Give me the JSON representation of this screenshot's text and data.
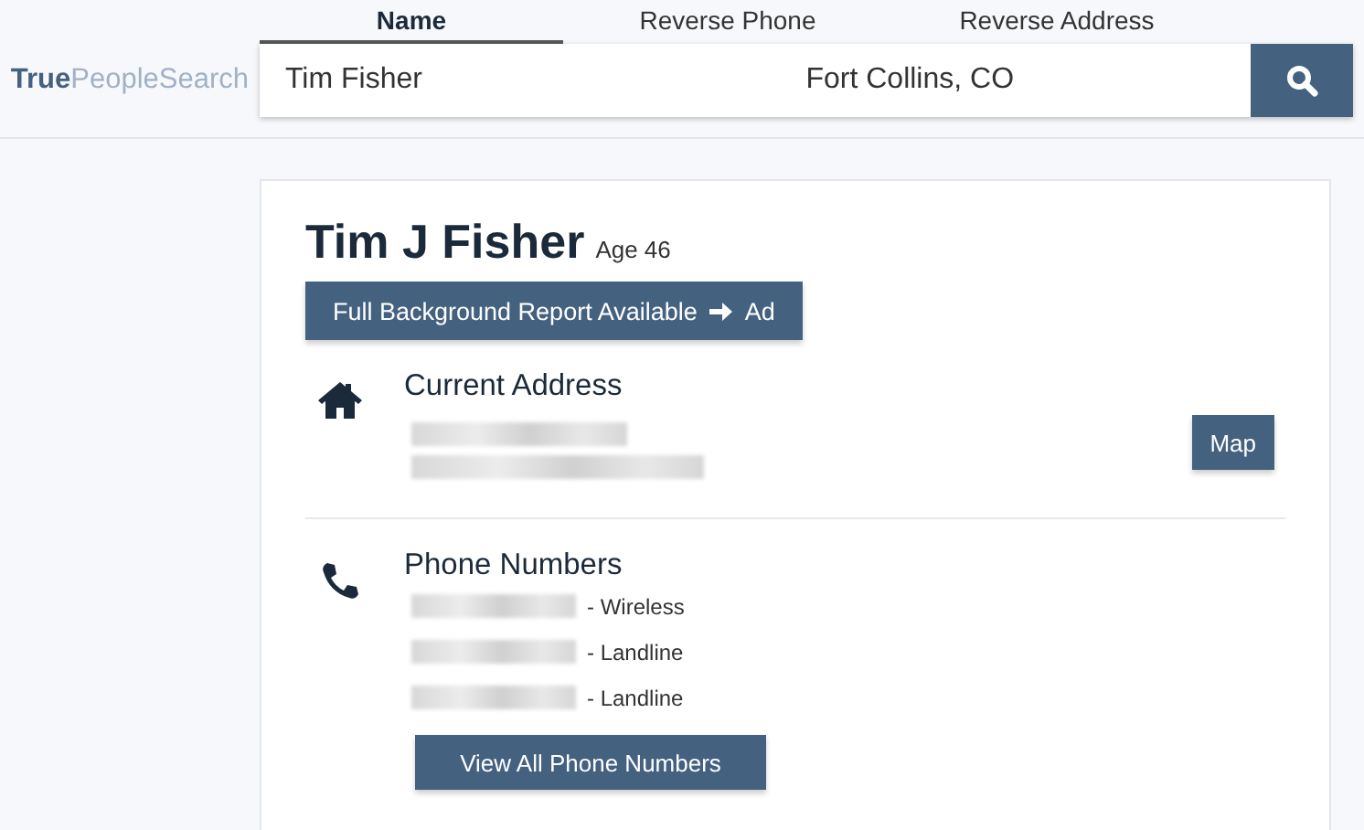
{
  "logo": {
    "bold": "True",
    "light": "PeopleSearch"
  },
  "tabs": [
    {
      "label": "Name",
      "selected": true
    },
    {
      "label": "Reverse Phone",
      "selected": false
    },
    {
      "label": "Reverse Address",
      "selected": false
    }
  ],
  "search": {
    "name": "Tim Fisher",
    "location": "Fort Collins, CO"
  },
  "person": {
    "name": "Tim J Fisher",
    "age": "Age 46"
  },
  "report_button": {
    "label": "Full Background Report Available",
    "suffix": "Ad"
  },
  "address": {
    "heading": "Current Address",
    "map_button": "Map"
  },
  "phones": {
    "heading": "Phone Numbers",
    "items": [
      {
        "type": "- Wireless"
      },
      {
        "type": "- Landline"
      },
      {
        "type": "- Landline"
      }
    ],
    "button": "View All Phone Numbers"
  }
}
